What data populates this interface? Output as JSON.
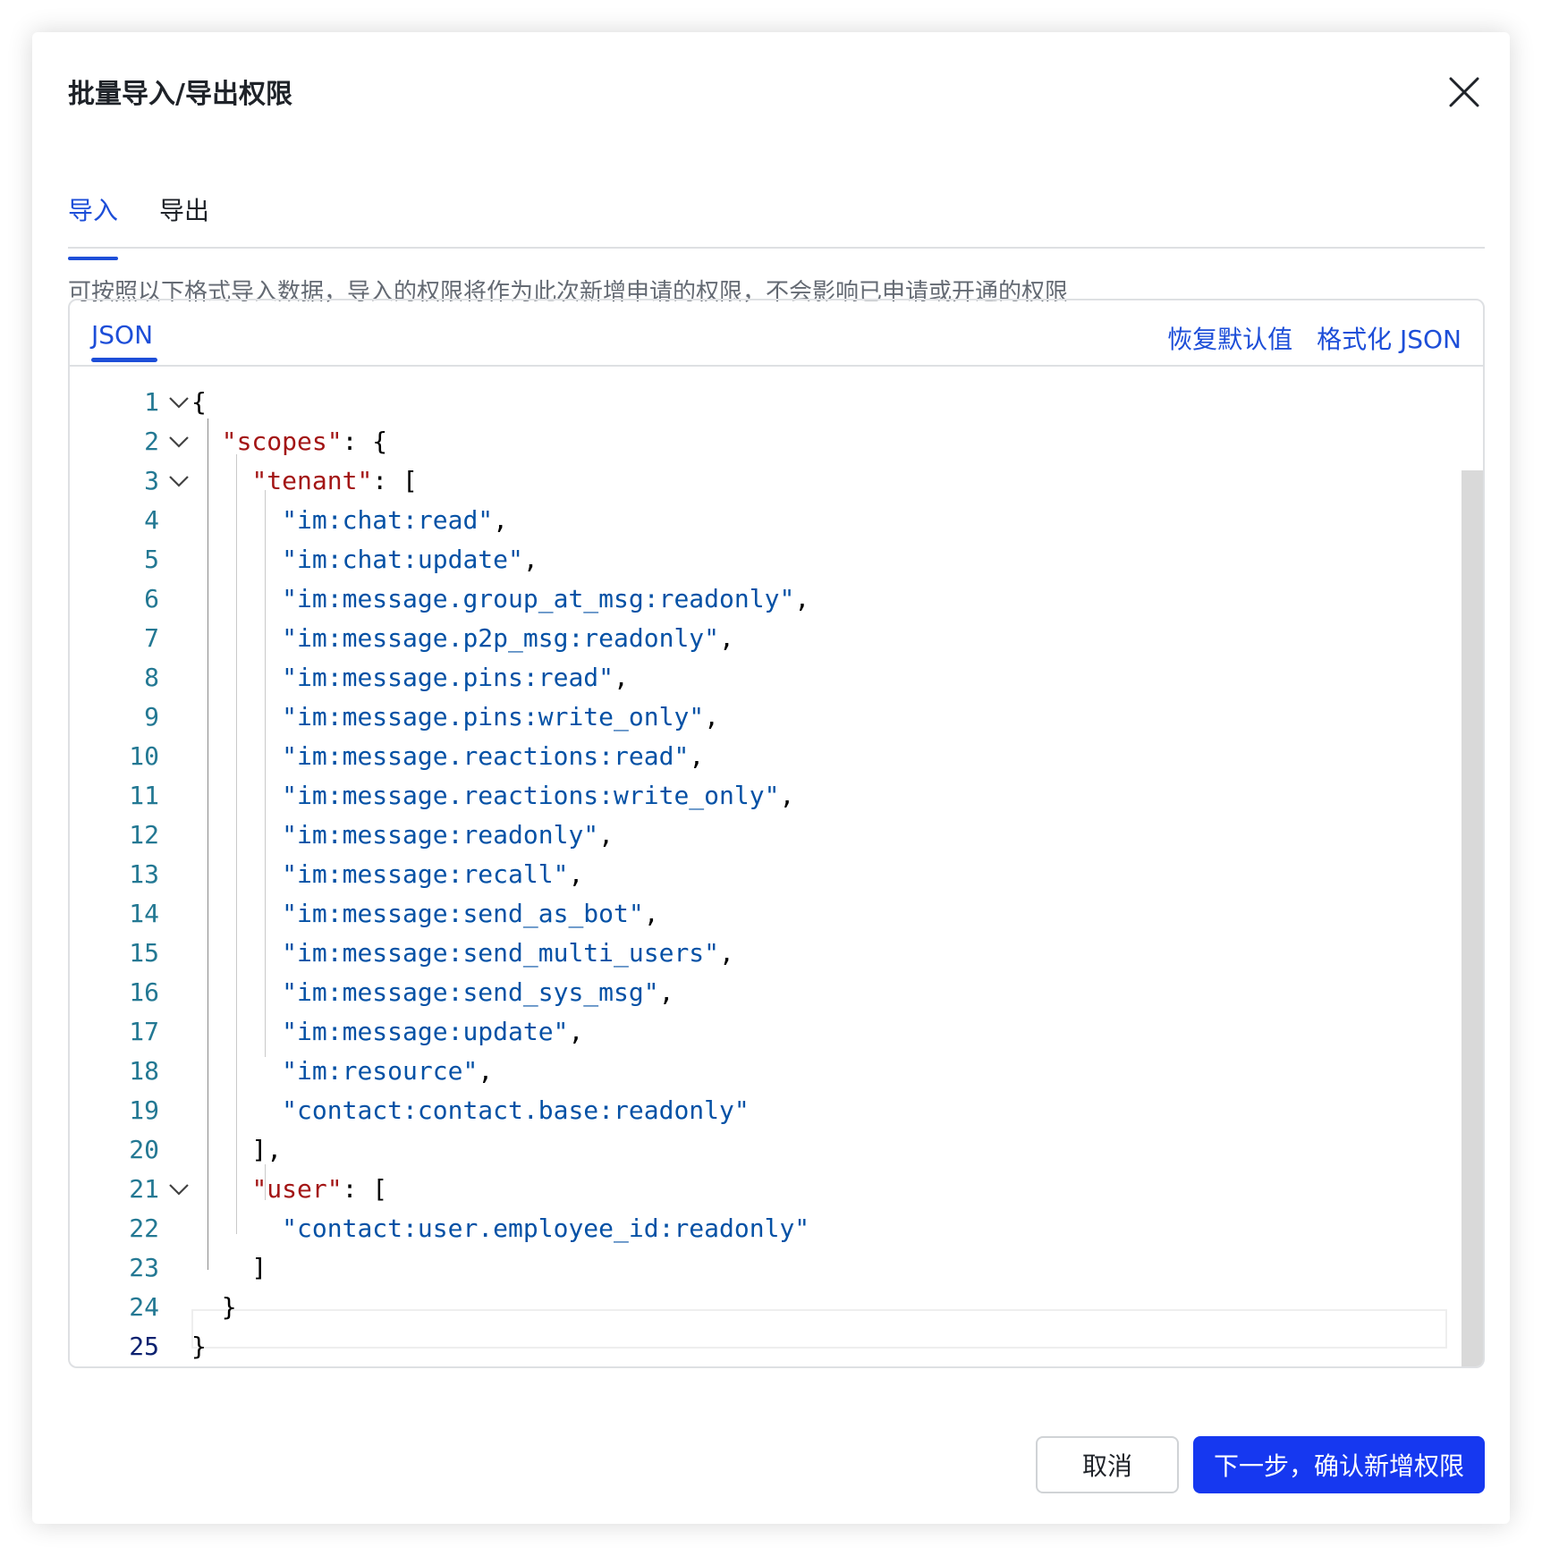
{
  "dialog": {
    "title": "批量导入/导出权限",
    "close_icon": "close-icon"
  },
  "tabs": [
    {
      "label": "导入",
      "active": true
    },
    {
      "label": "导出",
      "active": false
    }
  ],
  "description": "可按照以下格式导入数据，导入的权限将作为此次新增申请的权限，不会影响已申请或开通的权限",
  "editor": {
    "tab_label": "JSON",
    "actions": [
      "恢复默认值",
      "格式化 JSON"
    ],
    "lines": [
      {
        "no": "1",
        "fold": true,
        "tokens": [
          {
            "t": "p",
            "v": "{"
          }
        ]
      },
      {
        "no": "2",
        "fold": true,
        "tokens": [
          {
            "t": "p",
            "v": "  "
          },
          {
            "t": "k",
            "v": "\"scopes\""
          },
          {
            "t": "p",
            "v": ": {"
          }
        ]
      },
      {
        "no": "3",
        "fold": true,
        "tokens": [
          {
            "t": "p",
            "v": "    "
          },
          {
            "t": "k",
            "v": "\"tenant\""
          },
          {
            "t": "p",
            "v": ": ["
          }
        ]
      },
      {
        "no": "4",
        "fold": false,
        "tokens": [
          {
            "t": "p",
            "v": "      "
          },
          {
            "t": "s",
            "v": "\"im:chat:read\""
          },
          {
            "t": "p",
            "v": ","
          }
        ]
      },
      {
        "no": "5",
        "fold": false,
        "tokens": [
          {
            "t": "p",
            "v": "      "
          },
          {
            "t": "s",
            "v": "\"im:chat:update\""
          },
          {
            "t": "p",
            "v": ","
          }
        ]
      },
      {
        "no": "6",
        "fold": false,
        "tokens": [
          {
            "t": "p",
            "v": "      "
          },
          {
            "t": "s",
            "v": "\"im:message.group_at_msg:readonly\""
          },
          {
            "t": "p",
            "v": ","
          }
        ]
      },
      {
        "no": "7",
        "fold": false,
        "tokens": [
          {
            "t": "p",
            "v": "      "
          },
          {
            "t": "s",
            "v": "\"im:message.p2p_msg:readonly\""
          },
          {
            "t": "p",
            "v": ","
          }
        ]
      },
      {
        "no": "8",
        "fold": false,
        "tokens": [
          {
            "t": "p",
            "v": "      "
          },
          {
            "t": "s",
            "v": "\"im:message.pins:read\""
          },
          {
            "t": "p",
            "v": ","
          }
        ]
      },
      {
        "no": "9",
        "fold": false,
        "tokens": [
          {
            "t": "p",
            "v": "      "
          },
          {
            "t": "s",
            "v": "\"im:message.pins:write_only\""
          },
          {
            "t": "p",
            "v": ","
          }
        ]
      },
      {
        "no": "10",
        "fold": false,
        "tokens": [
          {
            "t": "p",
            "v": "      "
          },
          {
            "t": "s",
            "v": "\"im:message.reactions:read\""
          },
          {
            "t": "p",
            "v": ","
          }
        ]
      },
      {
        "no": "11",
        "fold": false,
        "tokens": [
          {
            "t": "p",
            "v": "      "
          },
          {
            "t": "s",
            "v": "\"im:message.reactions:write_only\""
          },
          {
            "t": "p",
            "v": ","
          }
        ]
      },
      {
        "no": "12",
        "fold": false,
        "tokens": [
          {
            "t": "p",
            "v": "      "
          },
          {
            "t": "s",
            "v": "\"im:message:readonly\""
          },
          {
            "t": "p",
            "v": ","
          }
        ]
      },
      {
        "no": "13",
        "fold": false,
        "tokens": [
          {
            "t": "p",
            "v": "      "
          },
          {
            "t": "s",
            "v": "\"im:message:recall\""
          },
          {
            "t": "p",
            "v": ","
          }
        ]
      },
      {
        "no": "14",
        "fold": false,
        "tokens": [
          {
            "t": "p",
            "v": "      "
          },
          {
            "t": "s",
            "v": "\"im:message:send_as_bot\""
          },
          {
            "t": "p",
            "v": ","
          }
        ]
      },
      {
        "no": "15",
        "fold": false,
        "tokens": [
          {
            "t": "p",
            "v": "      "
          },
          {
            "t": "s",
            "v": "\"im:message:send_multi_users\""
          },
          {
            "t": "p",
            "v": ","
          }
        ]
      },
      {
        "no": "16",
        "fold": false,
        "tokens": [
          {
            "t": "p",
            "v": "      "
          },
          {
            "t": "s",
            "v": "\"im:message:send_sys_msg\""
          },
          {
            "t": "p",
            "v": ","
          }
        ]
      },
      {
        "no": "17",
        "fold": false,
        "tokens": [
          {
            "t": "p",
            "v": "      "
          },
          {
            "t": "s",
            "v": "\"im:message:update\""
          },
          {
            "t": "p",
            "v": ","
          }
        ]
      },
      {
        "no": "18",
        "fold": false,
        "tokens": [
          {
            "t": "p",
            "v": "      "
          },
          {
            "t": "s",
            "v": "\"im:resource\""
          },
          {
            "t": "p",
            "v": ","
          }
        ]
      },
      {
        "no": "19",
        "fold": false,
        "tokens": [
          {
            "t": "p",
            "v": "      "
          },
          {
            "t": "s",
            "v": "\"contact:contact.base:readonly\""
          }
        ]
      },
      {
        "no": "20",
        "fold": false,
        "tokens": [
          {
            "t": "p",
            "v": "    ],"
          }
        ]
      },
      {
        "no": "21",
        "fold": true,
        "tokens": [
          {
            "t": "p",
            "v": "    "
          },
          {
            "t": "k",
            "v": "\"user\""
          },
          {
            "t": "p",
            "v": ": ["
          }
        ]
      },
      {
        "no": "22",
        "fold": false,
        "tokens": [
          {
            "t": "p",
            "v": "      "
          },
          {
            "t": "s",
            "v": "\"contact:user.employee_id:readonly\""
          }
        ]
      },
      {
        "no": "23",
        "fold": false,
        "tokens": [
          {
            "t": "p",
            "v": "    ]"
          }
        ]
      },
      {
        "no": "24",
        "fold": false,
        "tokens": [
          {
            "t": "p",
            "v": "  }"
          }
        ]
      },
      {
        "no": "25",
        "fold": false,
        "tokens": [
          {
            "t": "p",
            "v": "}"
          }
        ]
      }
    ]
  },
  "footer": {
    "cancel_label": "取消",
    "confirm_label": "下一步，确认新增权限"
  },
  "colors": {
    "accent": "#1d4ed8",
    "primary_button": "#1638f0",
    "json_key": "#a31515",
    "json_string": "#0451a5",
    "line_number": "#237893"
  }
}
